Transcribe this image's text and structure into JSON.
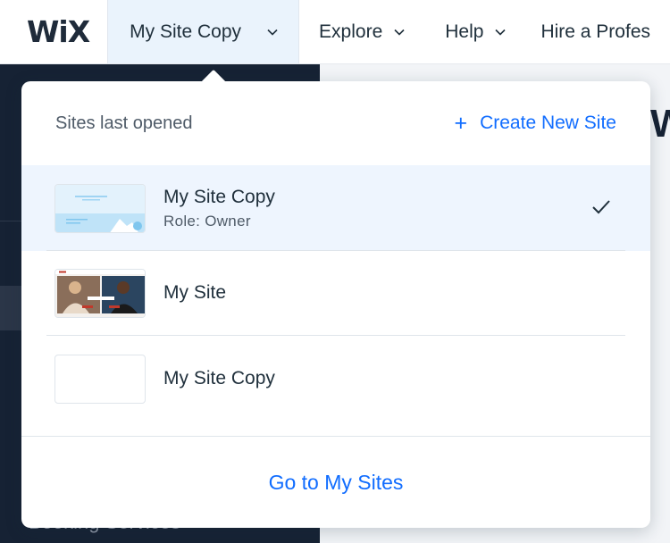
{
  "topbar": {
    "logo": "WiX",
    "site_selector": "My Site Copy",
    "nav": [
      {
        "label": "Explore"
      },
      {
        "label": "Help"
      },
      {
        "label": "Hire a Profes"
      }
    ]
  },
  "background": {
    "left_text": "Booking Services",
    "main_letter": "W"
  },
  "dropdown": {
    "heading": "Sites last opened",
    "create_label": "Create New Site",
    "sites": [
      {
        "name": "My Site Copy",
        "role": "Role: Owner",
        "selected": true
      },
      {
        "name": "My Site",
        "role": "",
        "selected": false
      },
      {
        "name": "My Site Copy",
        "role": "",
        "selected": false
      }
    ],
    "footer_label": "Go to My Sites"
  },
  "colors": {
    "accent": "#116dff",
    "selected_row": "#eef5fe",
    "sidebar": "#162234"
  },
  "icons": {
    "plus": "plus-icon",
    "check": "checkmark-icon",
    "chevron": "chevron-down-icon"
  }
}
